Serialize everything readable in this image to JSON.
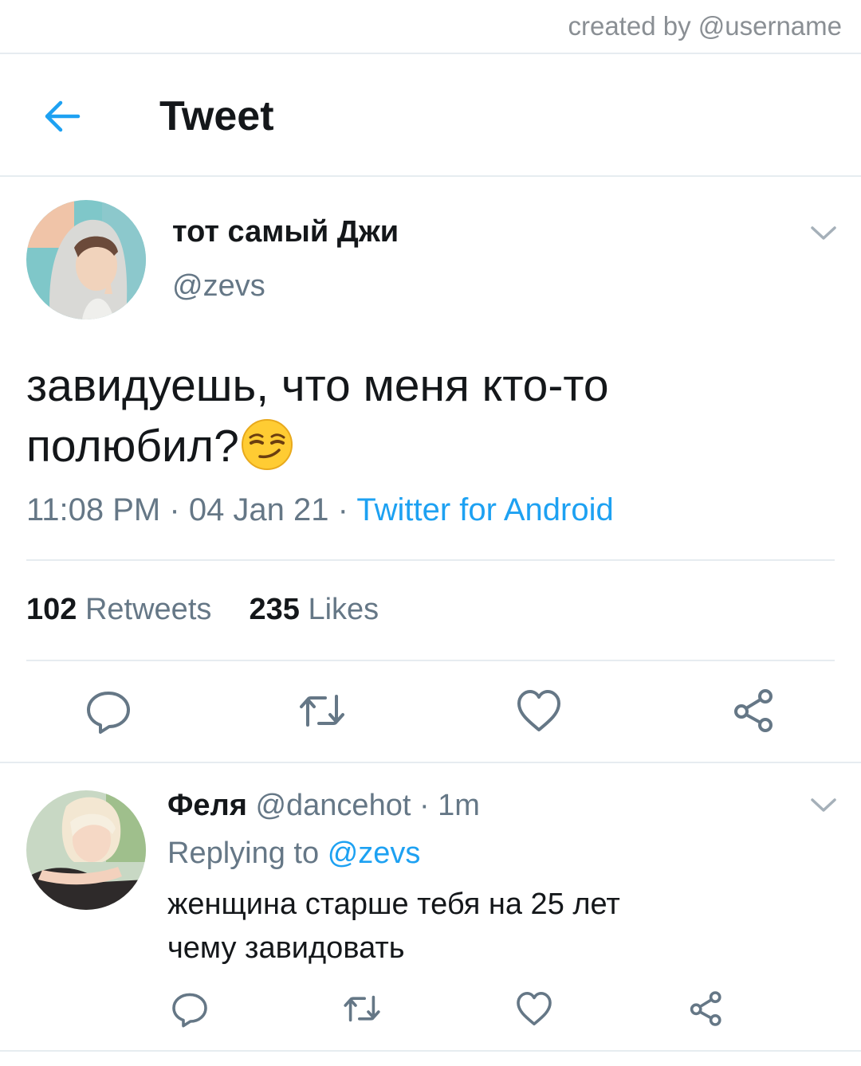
{
  "credit": "created by @username",
  "header": {
    "title": "Tweet"
  },
  "tweet": {
    "author_name": "тот самый Джи",
    "author_handle": "@zevs",
    "text": "завидуешь, что меня кто-то полюбил?",
    "time": "11:08 PM",
    "date": "04 Jan 21",
    "source": "Twitter for Android",
    "retweets_count": "102",
    "retweets_label": "Retweets",
    "likes_count": "235",
    "likes_label": "Likes",
    "emoji": "smirking-face"
  },
  "reply": {
    "author_name": "Феля",
    "author_handle": "@dancehot",
    "age": "1m",
    "replying_prefix": "Replying to",
    "replying_to": "@zevs",
    "text_line1": "женщина старше тебя на 25 лет",
    "text_line2": "чему завидовать"
  },
  "colors": {
    "accent": "#1da1f2",
    "secondary_text": "#657786",
    "divider": "#e6ecf0"
  },
  "icons": [
    "back-arrow-icon",
    "chevron-down-icon",
    "reply-icon",
    "retweet-icon",
    "like-icon",
    "share-icon"
  ]
}
